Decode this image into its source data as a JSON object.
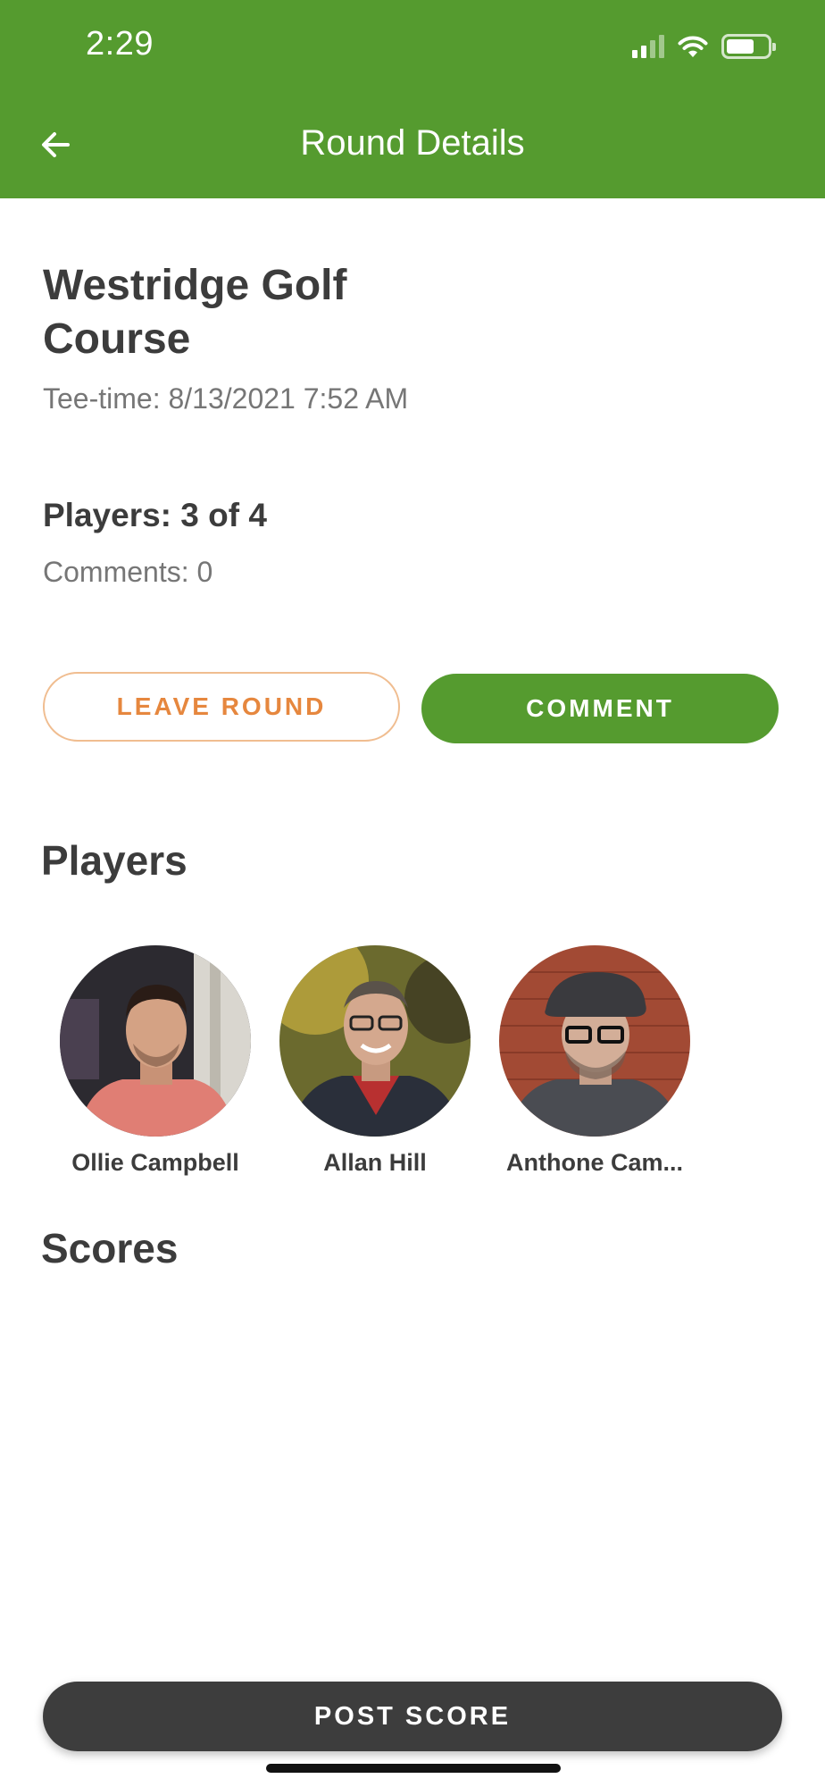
{
  "status_bar": {
    "time": "2:29"
  },
  "nav": {
    "title": "Round Details"
  },
  "round": {
    "course_name": "Westridge Golf Course",
    "tee_time": "Tee-time: 8/13/2021 7:52 AM",
    "players_count": "Players: 3 of 4",
    "comments_count": "Comments: 0"
  },
  "actions": {
    "leave_label": "LEAVE ROUND",
    "comment_label": "COMMENT"
  },
  "players_section": {
    "title": "Players",
    "players": [
      {
        "name": "Ollie Campbell"
      },
      {
        "name": "Allan Hill"
      },
      {
        "name": "Anthone Cam..."
      }
    ]
  },
  "scores_section": {
    "title": "Scores"
  },
  "footer": {
    "post_score_label": "POST SCORE"
  },
  "colors": {
    "brand_green": "#559b2f",
    "leave_orange": "#e6873e",
    "dark_button": "#3d3d3d"
  }
}
